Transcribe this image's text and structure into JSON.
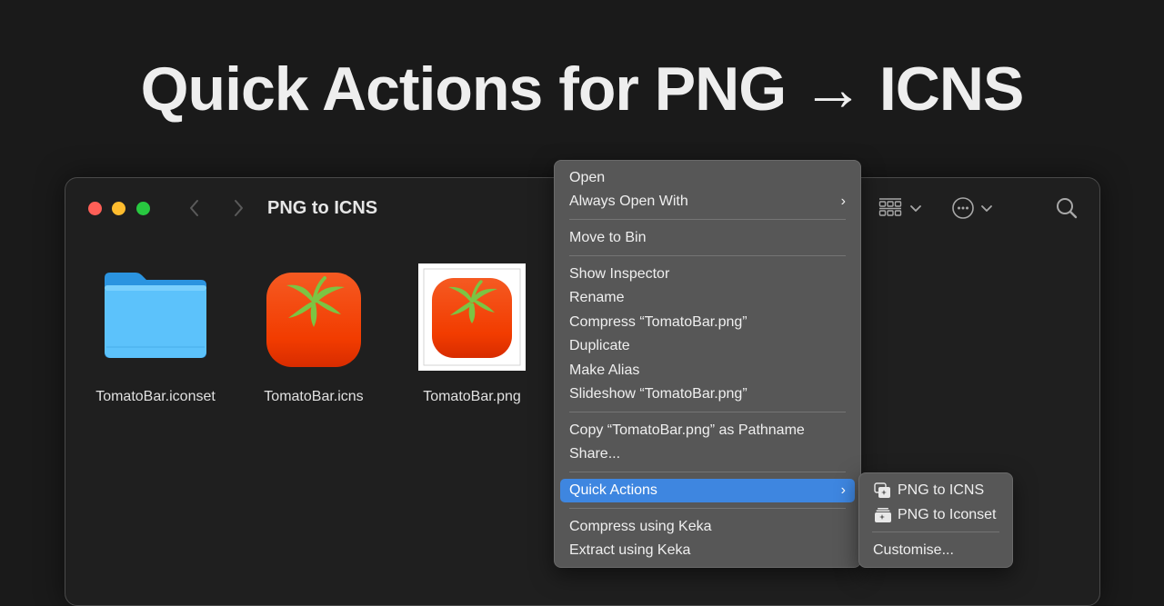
{
  "headline": "Quick Actions for PNG → ICNS",
  "window": {
    "title": "PNG to ICNS",
    "traffic_lights": {
      "close": "#fe5f57",
      "minimize": "#febc2e",
      "maximize": "#28c840"
    },
    "toolbar": {
      "back_icon": "chevron-left-icon",
      "forward_icon": "chevron-right-icon",
      "view_icon": "icon-grid-icon",
      "more_icon": "ellipsis-circle-icon",
      "search_icon": "magnifying-glass-icon"
    },
    "files": [
      {
        "name": "TomatoBar.iconset",
        "icon": "folder-icon"
      },
      {
        "name": "TomatoBar.icns",
        "icon": "tomato-app-icon"
      },
      {
        "name": "TomatoBar.png",
        "icon": "tomato-png-thumbnail"
      }
    ]
  },
  "context_menu": {
    "items": [
      {
        "label": "Open"
      },
      {
        "label": "Always Open With",
        "submenu": true
      },
      {
        "label": "Move to Bin"
      },
      {
        "label": "Show Inspector"
      },
      {
        "label": "Rename"
      },
      {
        "label": "Compress “TomatoBar.png”"
      },
      {
        "label": "Duplicate"
      },
      {
        "label": "Make Alias"
      },
      {
        "label": "Slideshow “TomatoBar.png”"
      },
      {
        "label": "Copy “TomatoBar.png” as Pathname"
      },
      {
        "label": "Share..."
      },
      {
        "label": "Quick Actions",
        "submenu": true,
        "highlighted": true
      },
      {
        "label": "Compress using Keka"
      },
      {
        "label": "Extract using Keka"
      }
    ],
    "highlight_color": "#3e86e0"
  },
  "quick_actions_submenu": {
    "items": [
      {
        "label": "PNG to ICNS",
        "icon": "automator-workflow-icon"
      },
      {
        "label": "PNG to Iconset",
        "icon": "automator-stack-icon"
      },
      {
        "label": "Customise..."
      }
    ]
  }
}
